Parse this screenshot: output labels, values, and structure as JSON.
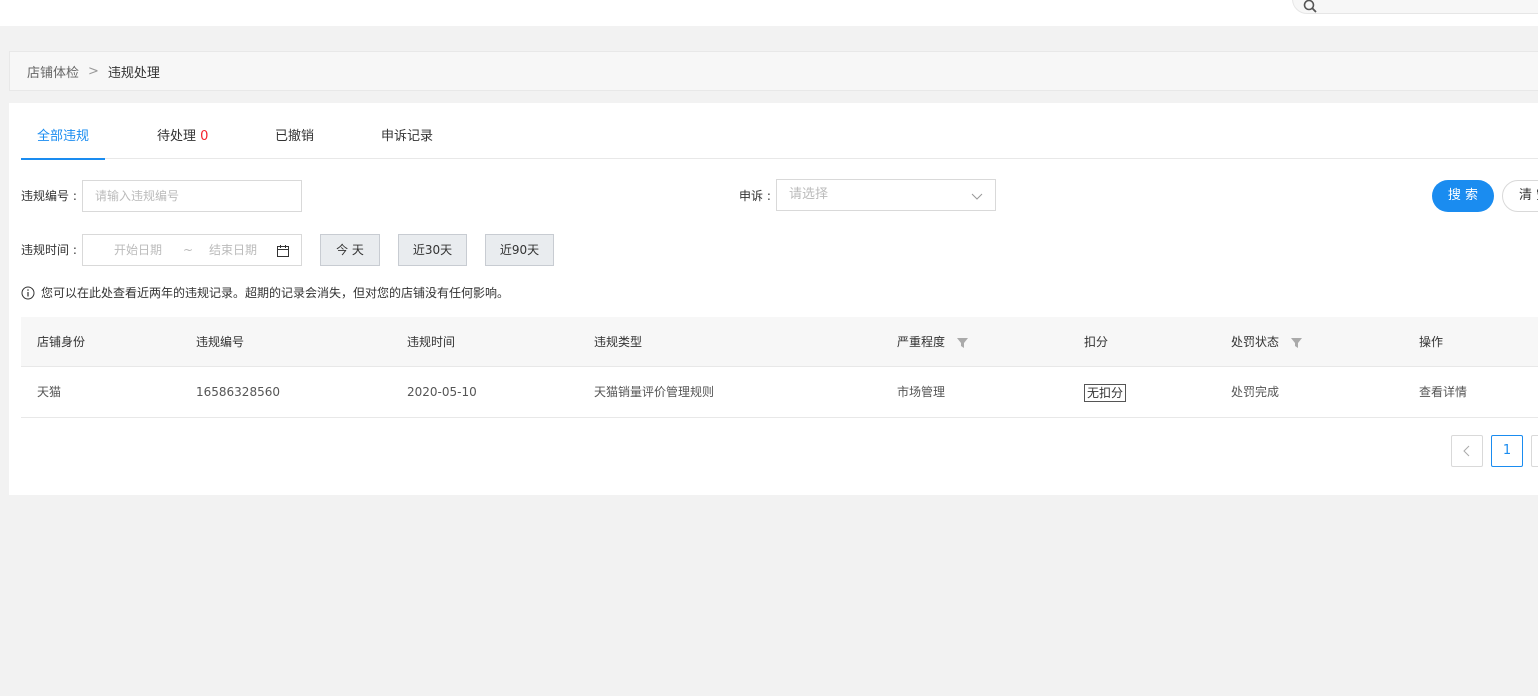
{
  "breadcrumb": {
    "parent": "店铺体检",
    "separator": ">",
    "current": "违规处理"
  },
  "tabs": [
    {
      "label": "全部违规",
      "active": true
    },
    {
      "label": "待处理",
      "count": "0",
      "active": false
    },
    {
      "label": "已撤销",
      "active": false
    },
    {
      "label": "申诉记录",
      "active": false
    }
  ],
  "filters": {
    "violation_no": {
      "label": "违规编号",
      "placeholder": "请输入违规编号",
      "value": ""
    },
    "appeal": {
      "label": "申诉",
      "placeholder": "请选择"
    },
    "violation_time": {
      "label": "违规时间",
      "start_placeholder": "开始日期",
      "range_sep": "~",
      "end_placeholder": "结束日期"
    },
    "quick_ranges": [
      "今 天",
      "近30天",
      "近90天"
    ],
    "search_label": "搜 索",
    "clear_label": "清 空"
  },
  "tip": "您可以在此处查看近两年的违规记录。超期的记录会消失，但对您的店铺没有任何影响。",
  "table": {
    "columns": [
      "店铺身份",
      "违规编号",
      "违规时间",
      "违规类型",
      "严重程度",
      "扣分",
      "处罚状态",
      "操作"
    ],
    "rows": [
      {
        "identity": "天猫",
        "violation_no": "16586328560",
        "time": "2020-05-10",
        "type": "天猫销量评价管理规则",
        "severity": "市场管理",
        "deduction": "无扣分",
        "status": "处罚完成",
        "action": "查看详情"
      }
    ]
  },
  "pagination": {
    "current": "1"
  },
  "colors": {
    "accent": "#1a8cf0",
    "alert": "#f5222d",
    "bg": "#f2f2f2"
  }
}
